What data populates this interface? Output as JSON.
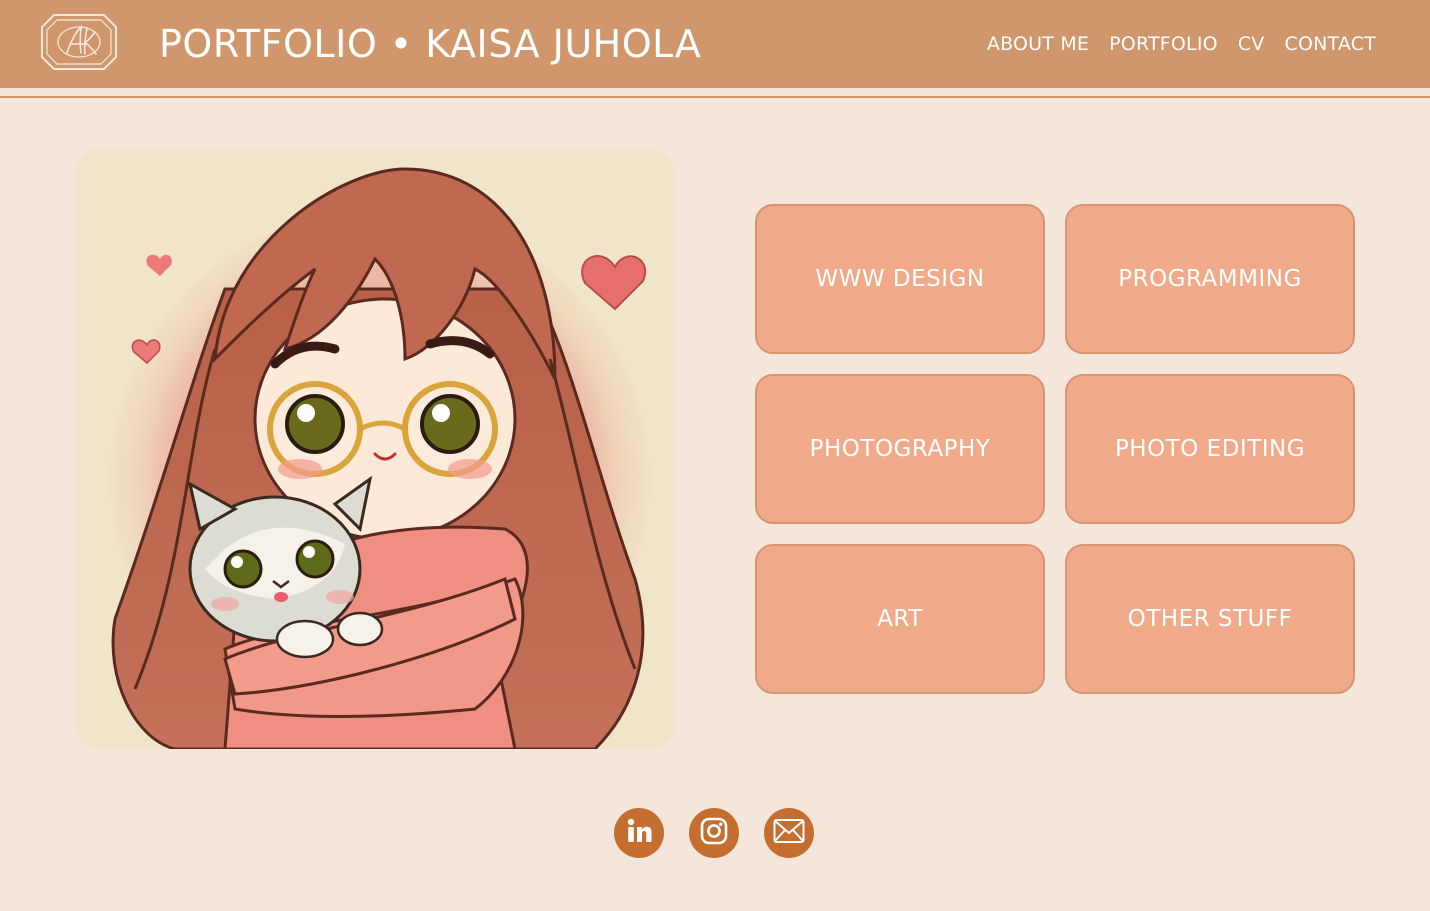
{
  "header": {
    "logo_monogram": "AK",
    "title": "PORTFOLIO • KAISA JUHOLA",
    "nav": [
      {
        "label": "ABOUT ME",
        "name": "nav-about-me"
      },
      {
        "label": "PORTFOLIO",
        "name": "nav-portfolio"
      },
      {
        "label": "CV",
        "name": "nav-cv"
      },
      {
        "label": "CONTACT",
        "name": "nav-contact"
      }
    ]
  },
  "hero": {
    "image_alt_semantic": "illustration-girl-with-cat"
  },
  "categories": [
    {
      "label": "WWW DESIGN"
    },
    {
      "label": "PROGRAMMING"
    },
    {
      "label": "PHOTOGRAPHY"
    },
    {
      "label": "PHOTO EDITING"
    },
    {
      "label": "ART"
    },
    {
      "label": "OTHER STUFF"
    }
  ],
  "socials": [
    {
      "icon": "linkedin-icon"
    },
    {
      "icon": "instagram-icon"
    },
    {
      "icon": "email-icon"
    }
  ],
  "colors": {
    "header_bg": "#d0966c",
    "page_bg": "#f5e6dc",
    "button_bg": "#f0aa8a",
    "button_border": "#d79472",
    "social_bg": "#c46e30",
    "text_light": "#ffffff"
  }
}
